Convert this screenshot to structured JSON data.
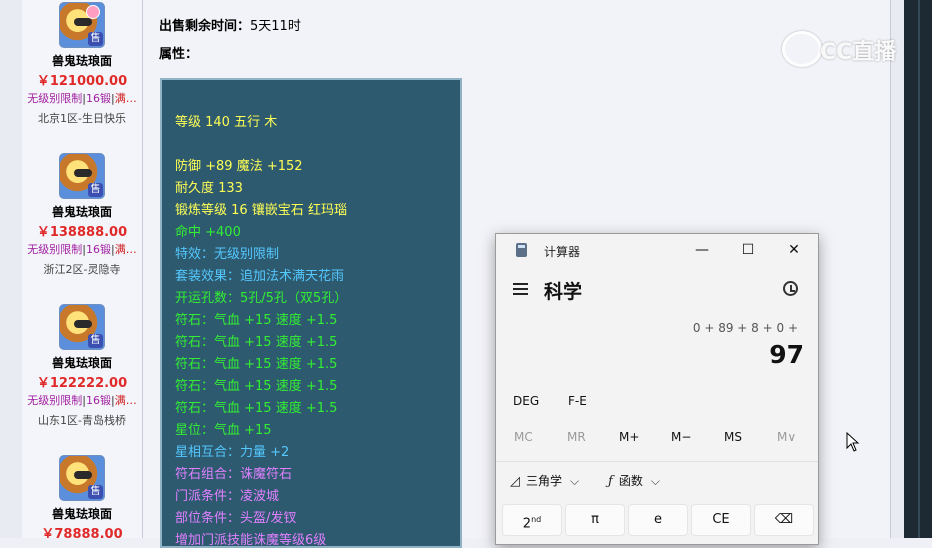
{
  "sidebar": {
    "items": [
      {
        "name": "兽鬼珐琅面",
        "price": "￥121000.00",
        "tag1": "无级别限制",
        "tag2": "16锻",
        "tag3": "满…",
        "server": "北京1区-生日快乐",
        "badge": "售",
        "has_pink_badge": true
      },
      {
        "name": "兽鬼珐琅面",
        "price": "￥138888.00",
        "tag1": "无级别限制",
        "tag2": "16锻",
        "tag3": "满…",
        "server": "浙江2区-灵隐寺",
        "badge": "售",
        "has_pink_badge": false
      },
      {
        "name": "兽鬼珐琅面",
        "price": "￥122222.00",
        "tag1": "无级别限制",
        "tag2": "16锻",
        "tag3": "满…",
        "server": "山东1区-青岛栈桥",
        "badge": "售",
        "has_pink_badge": false
      },
      {
        "name": "兽鬼珐琅面",
        "price": "￥78888.00",
        "badge": "售",
        "has_pink_badge": false
      }
    ],
    "separator": "|"
  },
  "detail": {
    "time_label": "出售剩余时间：",
    "time_value": "5天11时",
    "attr_label": "属性："
  },
  "attributes": {
    "lines": [
      {
        "text": "等级 140 五行 木",
        "color": "yellow"
      },
      {
        "text": "防御 +89 魔法 +152",
        "color": "yellow"
      },
      {
        "text": "耐久度 133",
        "color": "yellow"
      },
      {
        "text": "锻炼等级 16 镶嵌宝石 红玛瑙",
        "color": "yellow"
      },
      {
        "text": "命中 +400",
        "color": "green"
      },
      {
        "text": "特效：无级别限制",
        "color": "blue"
      },
      {
        "text": "套装效果：追加法术满天花雨",
        "color": "blue"
      },
      {
        "text": "开运孔数：5孔/5孔（双5孔）",
        "color": "green"
      },
      {
        "text": "符石：气血 +15 速度 +1.5",
        "color": "green"
      },
      {
        "text": "符石：气血 +15 速度 +1.5",
        "color": "green"
      },
      {
        "text": "符石：气血 +15 速度 +1.5",
        "color": "green"
      },
      {
        "text": "符石：气血 +15 速度 +1.5",
        "color": "green"
      },
      {
        "text": "符石：气血 +15 速度 +1.5",
        "color": "green"
      },
      {
        "text": "星位：气血 +15",
        "color": "green"
      },
      {
        "text": "星相互合：力量 +2",
        "color": "blue"
      },
      {
        "text": "符石组合：诛魔符石",
        "color": "violet"
      },
      {
        "text": "门派条件：凌波城",
        "color": "violet"
      },
      {
        "text": "部位条件：头盔/发钗",
        "color": "violet"
      },
      {
        "text": "增加门派技能诛魔等级6级",
        "color": "violet"
      }
    ]
  },
  "watermark": "CC直播",
  "calculator": {
    "title": "计算器",
    "mode": "科学",
    "expression": "0 + 89 + 8 + 0 +",
    "result": "97",
    "window_buttons": {
      "minimize": "—",
      "maximize": "☐",
      "close": "✕"
    },
    "angle_unit": "DEG",
    "fe_label": "F-E",
    "memory": [
      "MC",
      "MR",
      "M+",
      "M−",
      "MS",
      "M∨"
    ],
    "trig_label": "三角学",
    "func_label": "函数",
    "keys": [
      "2nd",
      "π",
      "e",
      "CE",
      "⌫"
    ],
    "colors": {
      "background": "#f3f3f3",
      "key": "#fbfbfb"
    }
  },
  "colors": {
    "attr_box": "#2d5a6f",
    "yellow": "#ffff55",
    "green": "#33ee33",
    "blue": "#55c8ff",
    "violet": "#e080ff",
    "price": "#e02a2a"
  }
}
